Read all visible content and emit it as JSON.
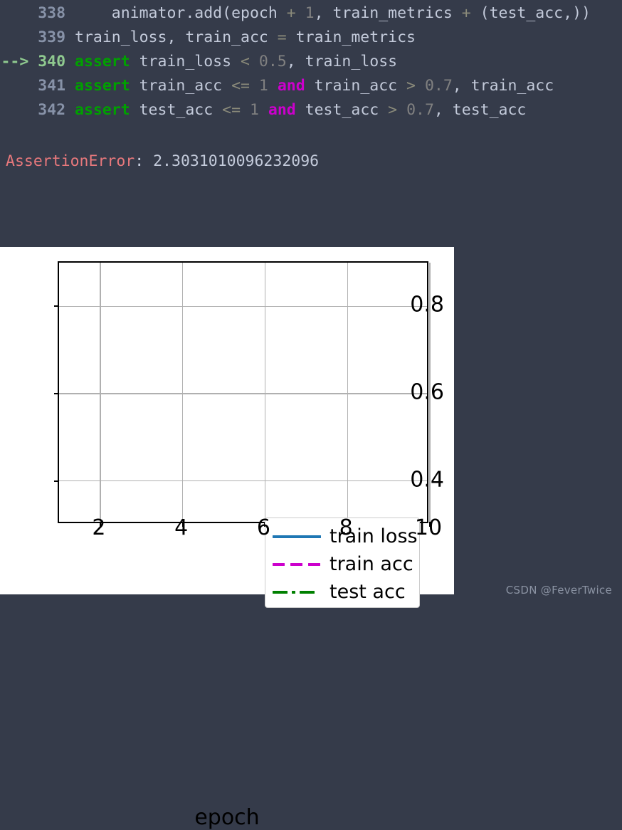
{
  "console": {
    "background_color": "#353b4a",
    "line_number_color": "#8792a8",
    "current_line_marker": "--> ",
    "lines": [
      {
        "number": "338",
        "marker": "",
        "is_current": false,
        "tokens": [
          {
            "t": "    animator",
            "c": "plain"
          },
          {
            "t": ".",
            "c": "punct"
          },
          {
            "t": "add",
            "c": "plain"
          },
          {
            "t": "(",
            "c": "punct"
          },
          {
            "t": "epoch ",
            "c": "plain"
          },
          {
            "t": "+",
            "c": "op"
          },
          {
            "t": " ",
            "c": "plain"
          },
          {
            "t": "1",
            "c": "num"
          },
          {
            "t": ", train_metrics ",
            "c": "plain"
          },
          {
            "t": "+",
            "c": "op"
          },
          {
            "t": " (test_acc,))",
            "c": "plain"
          }
        ]
      },
      {
        "number": "339",
        "marker": "",
        "is_current": false,
        "tokens": [
          {
            "t": "train_loss, train_acc ",
            "c": "plain"
          },
          {
            "t": "=",
            "c": "op"
          },
          {
            "t": " train_metrics",
            "c": "plain"
          }
        ]
      },
      {
        "number": "340",
        "marker": "--> ",
        "is_current": true,
        "tokens": [
          {
            "t": "assert",
            "c": "kw"
          },
          {
            "t": " train_loss ",
            "c": "plain"
          },
          {
            "t": "<",
            "c": "op"
          },
          {
            "t": " ",
            "c": "plain"
          },
          {
            "t": "0.5",
            "c": "num"
          },
          {
            "t": ", train_loss",
            "c": "plain"
          }
        ]
      },
      {
        "number": "341",
        "marker": "",
        "is_current": false,
        "tokens": [
          {
            "t": "assert",
            "c": "kw"
          },
          {
            "t": " train_acc ",
            "c": "plain"
          },
          {
            "t": "<=",
            "c": "op"
          },
          {
            "t": " ",
            "c": "plain"
          },
          {
            "t": "1",
            "c": "num"
          },
          {
            "t": " ",
            "c": "plain"
          },
          {
            "t": "and",
            "c": "kw2"
          },
          {
            "t": " train_acc ",
            "c": "plain"
          },
          {
            "t": ">",
            "c": "op"
          },
          {
            "t": " ",
            "c": "plain"
          },
          {
            "t": "0.7",
            "c": "num"
          },
          {
            "t": ", train_acc",
            "c": "plain"
          }
        ]
      },
      {
        "number": "342",
        "marker": "",
        "is_current": false,
        "tokens": [
          {
            "t": "assert",
            "c": "kw"
          },
          {
            "t": " test_acc ",
            "c": "plain"
          },
          {
            "t": "<=",
            "c": "op"
          },
          {
            "t": " ",
            "c": "plain"
          },
          {
            "t": "1",
            "c": "num"
          },
          {
            "t": " ",
            "c": "plain"
          },
          {
            "t": "and",
            "c": "kw2"
          },
          {
            "t": " test_acc ",
            "c": "plain"
          },
          {
            "t": ">",
            "c": "op"
          },
          {
            "t": " ",
            "c": "plain"
          },
          {
            "t": "0.7",
            "c": "num"
          },
          {
            "t": ", test_acc",
            "c": "plain"
          }
        ]
      }
    ],
    "error": {
      "name": "AssertionError",
      "separator": ": ",
      "value": "2.3031010096232096",
      "name_color": "#e8787c"
    }
  },
  "chart_data": {
    "type": "line",
    "title": "",
    "xlabel": "epoch",
    "ylabel": "",
    "grid": true,
    "legend_position": "upper right",
    "xlim": [
      1,
      10
    ],
    "ylim": [
      0.3,
      0.9
    ],
    "xticks": [
      "2",
      "4",
      "6",
      "8",
      "10"
    ],
    "xtick_values": [
      2,
      4,
      6,
      8,
      10
    ],
    "yticks": [
      "0.8",
      "0.6",
      "0.4"
    ],
    "ytick_values": [
      0.8,
      0.6,
      0.4
    ],
    "series": [
      {
        "name": "train loss",
        "color": "#1f77b4",
        "linestyle": "solid",
        "x": [],
        "values": []
      },
      {
        "name": "train acc",
        "color": "#cc00cc",
        "linestyle": "dashed",
        "x": [],
        "values": []
      },
      {
        "name": "test acc",
        "color": "#008000",
        "linestyle": "dashdot",
        "x": [],
        "values": []
      }
    ]
  },
  "watermark": {
    "text": "CSDN @FeverTwice"
  }
}
